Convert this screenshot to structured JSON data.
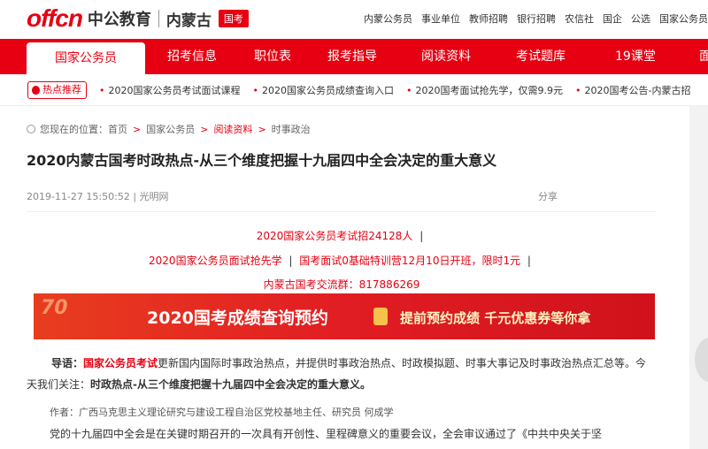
{
  "logo": {
    "brand": "offcn",
    "name": "中公教育",
    "region": "内蒙古",
    "badge": "国考"
  },
  "top_links": [
    "内蒙公务员",
    "事业单位",
    "教师招聘",
    "银行招聘",
    "农信社",
    "国企",
    "公选",
    "国家公务员"
  ],
  "nav": {
    "items": [
      "国家公务员",
      "招考信息",
      "职位表",
      "报考指导",
      "阅读资料",
      "考试题库",
      "19课堂",
      "面"
    ]
  },
  "hot": {
    "badge": "热点推荐",
    "items": [
      "2020国家公务员考试面试课程",
      "2020国家公务员成绩查询入口",
      "2020国考面试抢先学，仅需9.9元",
      "2020国考公告-内蒙古招"
    ]
  },
  "breadcrumb": {
    "prefix": "您现在的位置：",
    "items": [
      "首页",
      "国家公务员",
      "阅读资料",
      "时事政治"
    ]
  },
  "article": {
    "title": "2020内蒙古国考时政热点-从三个维度把握十九届四中全会决定的重大意义",
    "date": "2019-11-27 15:50:52",
    "source": "光明网",
    "share": "分享"
  },
  "promos": {
    "line1": "2020国家公务员考试招24128人",
    "line2a": "2020国家公务员面试抢先学",
    "line2b": "国考面试0基础特训营12月10日开班，限时1元",
    "line3": "内蒙古国考交流群：817886269",
    "pipe": "|"
  },
  "banner": {
    "deco": "70",
    "title": "2020国考成绩查询预约",
    "subtitle": "提前预约成绩 千元优惠券等你拿"
  },
  "intro": {
    "label": "导语：",
    "link": "国家公务员考试",
    "text1": "更新国内国际时事政治热点，并提供时事政治热点、时政模拟题、时事大事记及时事政治热点汇总等。今天我们关注：",
    "bold": "时政热点-从三个维度把握十九届四中全会决定的重大意义。"
  },
  "author": "作者：广西马克思主义理论研究与建设工程自治区党校基地主任、研究员 何成学",
  "body_line": "党的十九届四中全会是在关键时期召开的一次具有开创性、里程碑意义的重要会议，全会审议通过了《中共中央关于坚"
}
